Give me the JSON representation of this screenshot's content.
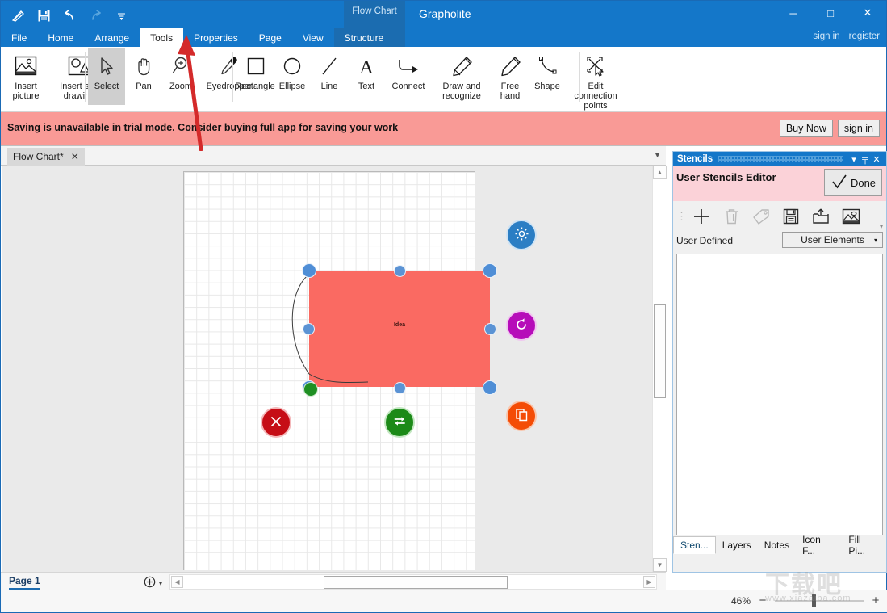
{
  "window": {
    "app_title": "Grapholite",
    "doc_chip": "Flow Chart",
    "minimize": "─",
    "maximize": "□",
    "close": "✕",
    "sign_in": "sign in",
    "register": "register"
  },
  "quick_access": [
    {
      "name": "pen-icon",
      "label": "pen"
    },
    {
      "name": "save-icon",
      "label": "save"
    },
    {
      "name": "undo-icon",
      "label": "undo"
    },
    {
      "name": "redo-icon",
      "label": "redo"
    },
    {
      "name": "customize-icon",
      "label": "customize"
    }
  ],
  "menu": {
    "items": [
      {
        "label": "File",
        "active": false
      },
      {
        "label": "Home",
        "active": false
      },
      {
        "label": "Arrange",
        "active": false
      },
      {
        "label": "Tools",
        "active": true
      },
      {
        "label": "Properties",
        "active": false
      },
      {
        "label": "Page",
        "active": false
      },
      {
        "label": "View",
        "active": false
      },
      {
        "label": "Structure",
        "active": false
      }
    ]
  },
  "ribbon": {
    "group_insert": [
      {
        "label": "Insert\npicture",
        "line1": "Insert",
        "line2": "picture",
        "icon": "insert-picture-icon"
      },
      {
        "label": "Insert svg drawing",
        "line1": "Insert svg",
        "line2": "drawing",
        "icon": "insert-svg-icon"
      }
    ],
    "group_tools": [
      {
        "line1": "Select",
        "line2": "",
        "icon": "cursor-icon",
        "selected": true
      },
      {
        "line1": "Pan",
        "line2": "",
        "icon": "hand-icon",
        "selected": false
      },
      {
        "line1": "Zoom",
        "line2": "",
        "icon": "magnifier-icon",
        "selected": false
      },
      {
        "line1": "Eyedropper",
        "line2": "",
        "icon": "eyedropper-icon",
        "selected": false
      }
    ],
    "group_shapes": [
      {
        "line1": "Rectangle",
        "line2": "",
        "icon": "rectangle-icon"
      },
      {
        "line1": "Ellipse",
        "line2": "",
        "icon": "ellipse-icon"
      },
      {
        "line1": "Line",
        "line2": "",
        "icon": "line-icon"
      },
      {
        "line1": "Text",
        "line2": "",
        "icon": "text-icon"
      },
      {
        "line1": "Connect",
        "line2": "",
        "icon": "connector-icon"
      },
      {
        "line1": "Draw and",
        "line2": "recognize",
        "icon": "pencil-recognize-icon"
      },
      {
        "line1": "Free",
        "line2": "hand",
        "icon": "pencil-icon"
      },
      {
        "line1": "Shape",
        "line2": "",
        "icon": "curve-shape-icon"
      },
      {
        "line1": "Edit connection",
        "line2": "points",
        "icon": "edit-connection-points-icon"
      }
    ]
  },
  "banner": {
    "message": "Saving is unavailable in trial mode. Consider buying full app for saving your work",
    "buy_now": "Buy Now",
    "sign_in": "sign in",
    "bg_color": "#f99a96"
  },
  "document_tab": {
    "label": "Flow Chart*",
    "close": "✕",
    "overflow_caret": "▼"
  },
  "canvas": {
    "shape": {
      "label": "Idea",
      "fill_color": "#fa6a62",
      "handle_color": "#4f8ed6",
      "green_handle_color": "#1f8f23"
    },
    "actions": [
      {
        "name": "settings-fab",
        "icon": "gear-icon",
        "color": "#2b7ec4"
      },
      {
        "name": "rotate-fab",
        "icon": "rotate-icon",
        "color": "#b60cb9"
      },
      {
        "name": "duplicate-fab",
        "icon": "copy-icon",
        "color": "#f44c06"
      },
      {
        "name": "delete-fab",
        "icon": "close-icon",
        "color": "#c60d16"
      },
      {
        "name": "swap-fab",
        "icon": "swap-arrows-icon",
        "color": "#1c8a18"
      }
    ],
    "scroll_up": "▲",
    "scroll_down": "▼",
    "scroll_left": "◀",
    "scroll_right": "▶"
  },
  "page_bar": {
    "page_tab": "Page 1",
    "add_page": "⊕",
    "add_page_caret": "▾"
  },
  "stencils": {
    "title": "Stencils",
    "collapse": "▾",
    "pin": "╤",
    "close": "✕",
    "editor_header": "User Stencils Editor",
    "done_label": "Done",
    "toolbar": [
      {
        "name": "add-stencil-button",
        "icon": "plus-icon",
        "enabled": true
      },
      {
        "name": "delete-stencil-button",
        "icon": "trash-icon",
        "enabled": false
      },
      {
        "name": "tag-stencil-button",
        "icon": "tag-icon",
        "enabled": false
      },
      {
        "name": "save-stencil-button",
        "icon": "floppy-icon",
        "enabled": true
      },
      {
        "name": "open-stencil-button",
        "icon": "open-folder-icon",
        "enabled": true
      },
      {
        "name": "import-image-button",
        "icon": "picture-icon",
        "enabled": true
      }
    ],
    "toolbar_overflow": "▾",
    "filter_label": "User Defined",
    "combo_value": "User Elements",
    "combo_caret": "▾",
    "tabs": [
      {
        "label": "Sten...",
        "active": true
      },
      {
        "label": "Layers",
        "active": false
      },
      {
        "label": "Notes",
        "active": false
      },
      {
        "label": "Icon F...",
        "active": false
      },
      {
        "label": "Fill Pi...",
        "active": false
      }
    ]
  },
  "status": {
    "zoom_pct": "46%",
    "zoom_out": "−",
    "zoom_in": "+"
  },
  "watermark": {
    "big": "下载吧",
    "small": "www.xiazaiba.com"
  }
}
